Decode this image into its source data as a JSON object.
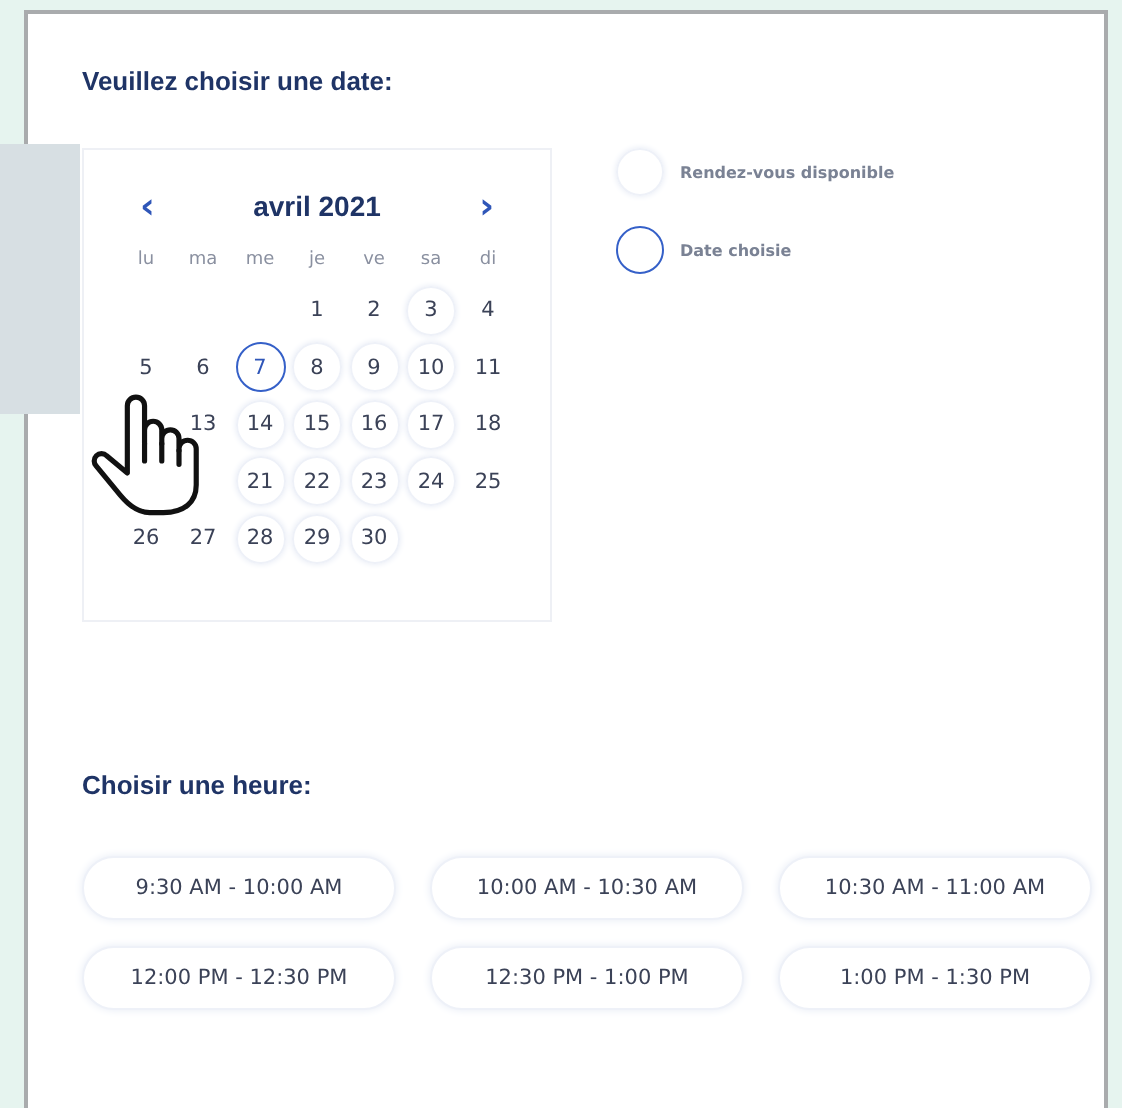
{
  "date_heading": "Veuillez choisir une date:",
  "calendar": {
    "prev": "‹",
    "month": "avril 2021",
    "next": "›",
    "weekdays": [
      "lu",
      "ma",
      "me",
      "je",
      "ve",
      "sa",
      "di"
    ],
    "weeks": [
      [
        {
          "kind": "blank"
        },
        {
          "kind": "blank"
        },
        {
          "kind": "blank"
        },
        {
          "kind": "day",
          "day": "1",
          "available": false,
          "selected": false
        },
        {
          "kind": "day",
          "day": "2",
          "available": false,
          "selected": false
        },
        {
          "kind": "day",
          "day": "3",
          "available": true,
          "selected": false
        },
        {
          "kind": "day",
          "day": "4",
          "available": false,
          "selected": false
        }
      ],
      [
        {
          "kind": "day",
          "day": "5",
          "available": false,
          "selected": false
        },
        {
          "kind": "day",
          "day": "6",
          "available": false,
          "selected": false
        },
        {
          "kind": "day",
          "day": "7",
          "available": true,
          "selected": true
        },
        {
          "kind": "day",
          "day": "8",
          "available": true,
          "selected": false
        },
        {
          "kind": "day",
          "day": "9",
          "available": true,
          "selected": false
        },
        {
          "kind": "day",
          "day": "10",
          "available": true,
          "selected": false
        },
        {
          "kind": "day",
          "day": "11",
          "available": false,
          "selected": false
        }
      ],
      [
        {
          "kind": "blank"
        },
        {
          "kind": "day",
          "day": "13",
          "available": false,
          "selected": false
        },
        {
          "kind": "day",
          "day": "14",
          "available": true,
          "selected": false
        },
        {
          "kind": "day",
          "day": "15",
          "available": true,
          "selected": false
        },
        {
          "kind": "day",
          "day": "16",
          "available": true,
          "selected": false
        },
        {
          "kind": "day",
          "day": "17",
          "available": true,
          "selected": false
        },
        {
          "kind": "day",
          "day": "18",
          "available": false,
          "selected": false
        }
      ],
      [
        {
          "kind": "blank"
        },
        {
          "kind": "blank"
        },
        {
          "kind": "day",
          "day": "21",
          "available": true,
          "selected": false
        },
        {
          "kind": "day",
          "day": "22",
          "available": true,
          "selected": false
        },
        {
          "kind": "day",
          "day": "23",
          "available": true,
          "selected": false
        },
        {
          "kind": "day",
          "day": "24",
          "available": true,
          "selected": false
        },
        {
          "kind": "day",
          "day": "25",
          "available": false,
          "selected": false
        }
      ],
      [
        {
          "kind": "day",
          "day": "26",
          "available": false,
          "selected": false
        },
        {
          "kind": "day",
          "day": "27",
          "available": false,
          "selected": false
        },
        {
          "kind": "day",
          "day": "28",
          "available": true,
          "selected": false
        },
        {
          "kind": "day",
          "day": "29",
          "available": true,
          "selected": false
        },
        {
          "kind": "day",
          "day": "30",
          "available": true,
          "selected": false
        },
        {
          "kind": "blank"
        },
        {
          "kind": "blank"
        }
      ]
    ]
  },
  "legend": [
    {
      "kind": "available",
      "label": "Rendez-vous disponible"
    },
    {
      "kind": "selected",
      "label": "Date choisie"
    }
  ],
  "time_heading": "Choisir une heure:",
  "time_slots": [
    "9:30 AM - 10:00 AM",
    "10:00 AM - 10:30 AM",
    "10:30 AM - 11:00 AM",
    "12:00 PM - 12:30 PM",
    "12:30 PM - 1:00 PM",
    "1:00 PM - 1:30 PM"
  ]
}
